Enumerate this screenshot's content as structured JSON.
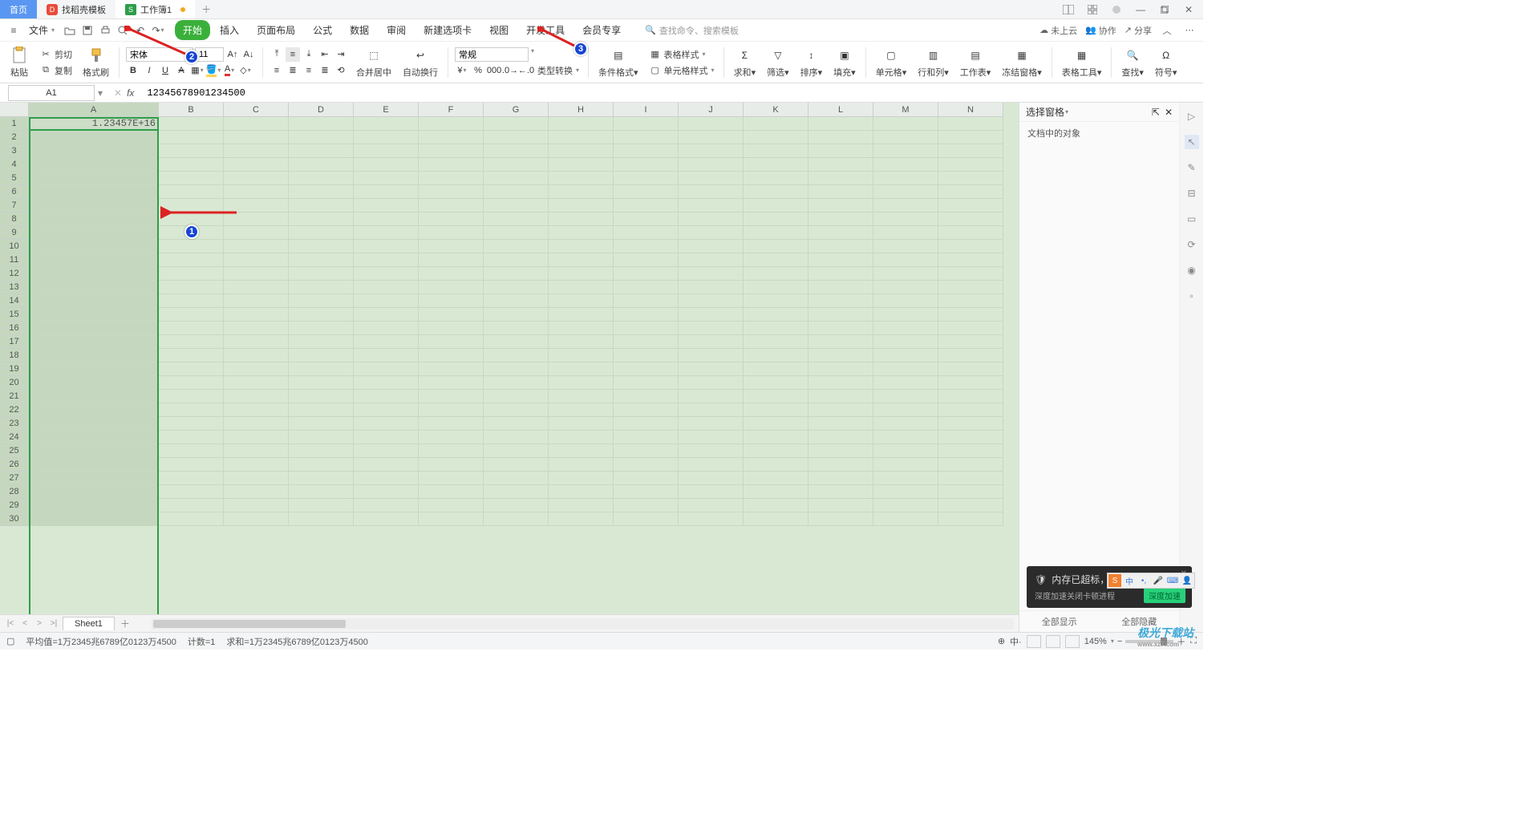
{
  "titlebar": {
    "tabs": [
      {
        "label": "首页",
        "kind": "home"
      },
      {
        "label": "找稻壳模板",
        "kind": "template"
      },
      {
        "label": "工作簿1",
        "kind": "workbook",
        "dirty": true
      }
    ]
  },
  "quick_access": {
    "file_label": "文件"
  },
  "menu": {
    "tabs": [
      "开始",
      "插入",
      "页面布局",
      "公式",
      "数据",
      "审阅",
      "新建选项卡",
      "视图",
      "开发工具",
      "会员专享"
    ],
    "active": "开始",
    "search_placeholder": "查找命令、搜索模板"
  },
  "menurow_right": {
    "cloud": "未上云",
    "coop": "协作",
    "share": "分享"
  },
  "ribbon": {
    "paste": "粘贴",
    "cut": "剪切",
    "copy": "复制",
    "format_painter": "格式刷",
    "font_name": "宋体",
    "font_size": "11",
    "merge_center": "合并居中",
    "wrap_text": "自动换行",
    "number_format": "常规",
    "type_convert": "类型转换",
    "cond_format": "条件格式",
    "table_style": "表格样式",
    "cell_style": "单元格样式",
    "sum": "求和",
    "filter": "筛选",
    "sort": "排序",
    "fill": "填充",
    "cell": "单元格",
    "row_col": "行和列",
    "worksheet": "工作表",
    "freeze": "冻结窗格",
    "table_tool": "表格工具",
    "find": "查找",
    "symbol": "符号"
  },
  "formula_bar": {
    "name_box": "A1",
    "value": "12345678901234500"
  },
  "grid": {
    "columns": [
      "A",
      "B",
      "C",
      "D",
      "E",
      "F",
      "G",
      "H",
      "I",
      "J",
      "K",
      "L",
      "M",
      "N"
    ],
    "row_count": 30,
    "cells": {
      "A1": "1.23457E+16"
    }
  },
  "side_panel": {
    "title": "选择窗格",
    "subtitle": "文档中的对象",
    "show_all": "全部显示",
    "hide_all": "全部隐藏"
  },
  "sheet_tabs": {
    "sheets": [
      "Sheet1"
    ]
  },
  "status": {
    "avg": "平均值=1万2345兆6789亿0123万4500",
    "count": "计数=1",
    "sum": "求和=1万2345兆6789亿0123万4500",
    "zoom": "145%"
  },
  "toast": {
    "title_prefix": "内存已超标，需要",
    "title_action": "深度加速",
    "subtitle": "深度加速关闭卡顿进程",
    "button": "深度加速"
  },
  "annotations": {
    "m1": "1",
    "m2": "2",
    "m3": "3"
  },
  "watermark": {
    "name": "极光下载站",
    "url": "www.xz7.com"
  }
}
